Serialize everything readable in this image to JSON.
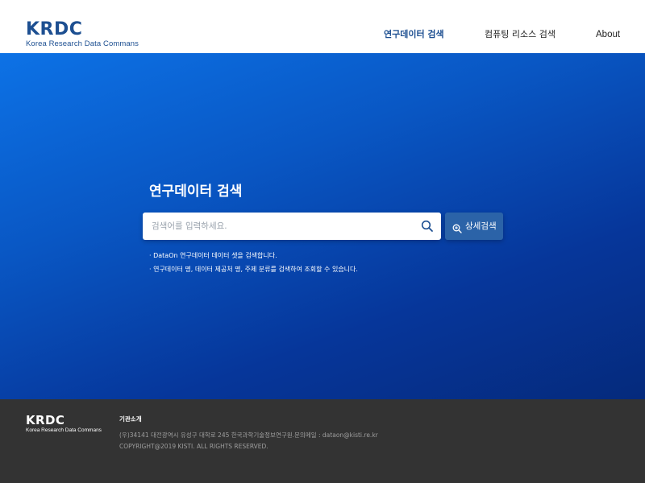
{
  "header": {
    "logo_title": "KRDC",
    "logo_subtitle": "Korea Research Data Commans",
    "nav": [
      {
        "label": "연구데이터 검색",
        "active": true
      },
      {
        "label": "컴퓨팅 리소스 검색",
        "active": false
      },
      {
        "label": "About",
        "active": false
      }
    ]
  },
  "hero": {
    "title": "연구데이터 검색",
    "search_placeholder": "검색어를 입력하세요.",
    "search_value": "",
    "search_icon": "search-icon",
    "advanced_button": "상세검색",
    "advanced_icon": "zoom-in-icon",
    "hints": [
      "· DataOn 연구데이터 데이터 셋을 검색합니다.",
      "· 연구데이터 명, 데이터 제공처 명, 주제 분류를 검색하여 조회할 수 있습니다."
    ]
  },
  "footer": {
    "logo_title": "KRDC",
    "logo_subtitle": "Korea Research Data Commans",
    "intro_label": "기관소개",
    "address": "(우)34141 대전광역시 유성구 대학로 245 한국과학기술정보연구원.문의메일 : dataon@kisti.re.kr",
    "copyright": "COPYRIGHT@2019 KISTI. ALL RIGHTS RESERVED."
  },
  "colors": {
    "brand": "#1d4f91",
    "hero_start": "#0d72e6",
    "hero_end": "#052a7c",
    "advanced_button": "#2b63a8",
    "footer_bg": "#333333"
  }
}
